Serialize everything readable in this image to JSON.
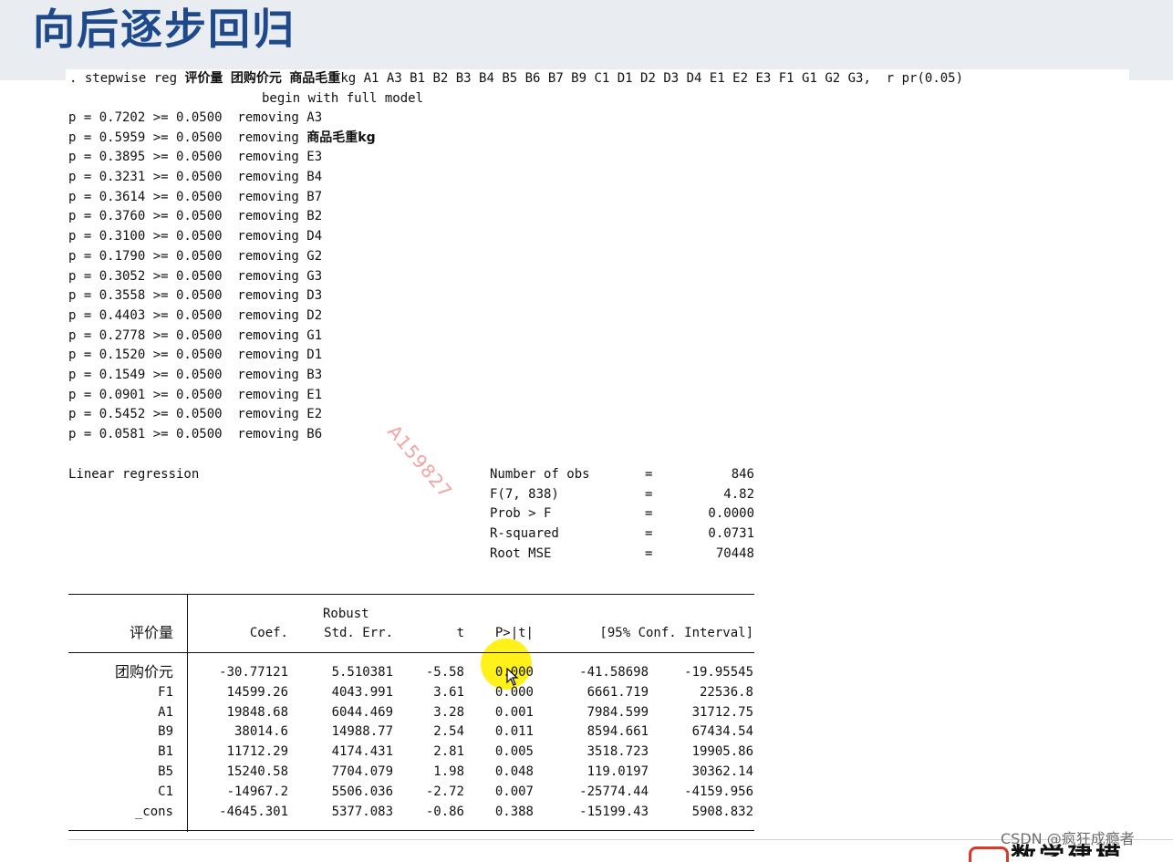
{
  "title": "向后逐步回归",
  "command": {
    "prefix": ". stepwise reg ",
    "dep_var": "评价量",
    "var1": "团购价元",
    "var2": "商品毛重",
    "rest": "kg A1 A3 B1 B2 B3 B4 B5 B6 B7 B9 C1 D1 D2 D3 D4 E1 E2 E3 F1 G1 G2 G3,  r pr(0.05)"
  },
  "begin_text": "begin with full model",
  "steps": [
    {
      "p": "p = 0.7202 >= 0.0500  removing ",
      "var": "A3"
    },
    {
      "p": "p = 0.5959 >= 0.0500  removing ",
      "var": "商品毛重",
      "suffix": "kg"
    },
    {
      "p": "p = 0.3895 >= 0.0500  removing ",
      "var": "E3"
    },
    {
      "p": "p = 0.3231 >= 0.0500  removing ",
      "var": "B4"
    },
    {
      "p": "p = 0.3614 >= 0.0500  removing ",
      "var": "B7"
    },
    {
      "p": "p = 0.3760 >= 0.0500  removing ",
      "var": "B2"
    },
    {
      "p": "p = 0.3100 >= 0.0500  removing ",
      "var": "D4"
    },
    {
      "p": "p = 0.1790 >= 0.0500  removing ",
      "var": "G2"
    },
    {
      "p": "p = 0.3052 >= 0.0500  removing ",
      "var": "G3"
    },
    {
      "p": "p = 0.3558 >= 0.0500  removing ",
      "var": "D3"
    },
    {
      "p": "p = 0.4403 >= 0.0500  removing ",
      "var": "D2"
    },
    {
      "p": "p = 0.2778 >= 0.0500  removing ",
      "var": "G1"
    },
    {
      "p": "p = 0.1520 >= 0.0500  removing ",
      "var": "D1"
    },
    {
      "p": "p = 0.1549 >= 0.0500  removing ",
      "var": "B3"
    },
    {
      "p": "p = 0.0901 >= 0.0500  removing ",
      "var": "E1"
    },
    {
      "p": "p = 0.5452 >= 0.0500  removing ",
      "var": "E2"
    },
    {
      "p": "p = 0.0581 >= 0.0500  removing ",
      "var": "B6"
    }
  ],
  "watermark": "A159827",
  "regression": {
    "title": "Linear regression",
    "stats": [
      {
        "label": "Number of obs",
        "eq": "=",
        "value": "846"
      },
      {
        "label": "F(7, 838)",
        "eq": "=",
        "value": "4.82"
      },
      {
        "label": "Prob > F",
        "eq": "=",
        "value": "0.0000"
      },
      {
        "label": "R-squared",
        "eq": "=",
        "value": "0.0731"
      },
      {
        "label": "Root MSE",
        "eq": "=",
        "value": "70448"
      }
    ]
  },
  "table": {
    "robust": "Robust",
    "dep_var": "评价量",
    "headers": [
      "Coef.",
      "Std. Err.",
      "t",
      "P>|t|",
      "[95% Conf. Interval]"
    ],
    "rows": [
      {
        "name": "团购价元",
        "coef": "-30.77121",
        "se": "5.510381",
        "t": "-5.58",
        "p": "0.000",
        "lo": "-41.58698",
        "hi": "-19.95545"
      },
      {
        "name": "F1",
        "coef": "14599.26",
        "se": "4043.991",
        "t": "3.61",
        "p": "0.000",
        "lo": "6661.719",
        "hi": "22536.8"
      },
      {
        "name": "A1",
        "coef": "19848.68",
        "se": "6044.469",
        "t": "3.28",
        "p": "0.001",
        "lo": "7984.599",
        "hi": "31712.75"
      },
      {
        "name": "B9",
        "coef": "38014.6",
        "se": "14988.77",
        "t": "2.54",
        "p": "0.011",
        "lo": "8594.661",
        "hi": "67434.54"
      },
      {
        "name": "B1",
        "coef": "11712.29",
        "se": "4174.431",
        "t": "2.81",
        "p": "0.005",
        "lo": "3518.723",
        "hi": "19905.86"
      },
      {
        "name": "B5",
        "coef": "15240.58",
        "se": "7704.079",
        "t": "1.98",
        "p": "0.048",
        "lo": "119.0197",
        "hi": "30362.14"
      },
      {
        "name": "C1",
        "coef": "-14967.2",
        "se": "5506.036",
        "t": "-2.72",
        "p": "0.007",
        "lo": "-25774.44",
        "hi": "-4159.956"
      },
      {
        "name": "_cons",
        "coef": "-4645.301",
        "se": "5377.083",
        "t": "-0.86",
        "p": "0.388",
        "lo": "-15199.43",
        "hi": "5908.832"
      }
    ]
  },
  "footer": {
    "csdn": "CSDN @疯狂成瘾者"
  },
  "colors": {
    "title": "#1e4a8c",
    "band": "#e9edf1",
    "highlight": "#fff000",
    "watermark": "#f2a3a3"
  }
}
